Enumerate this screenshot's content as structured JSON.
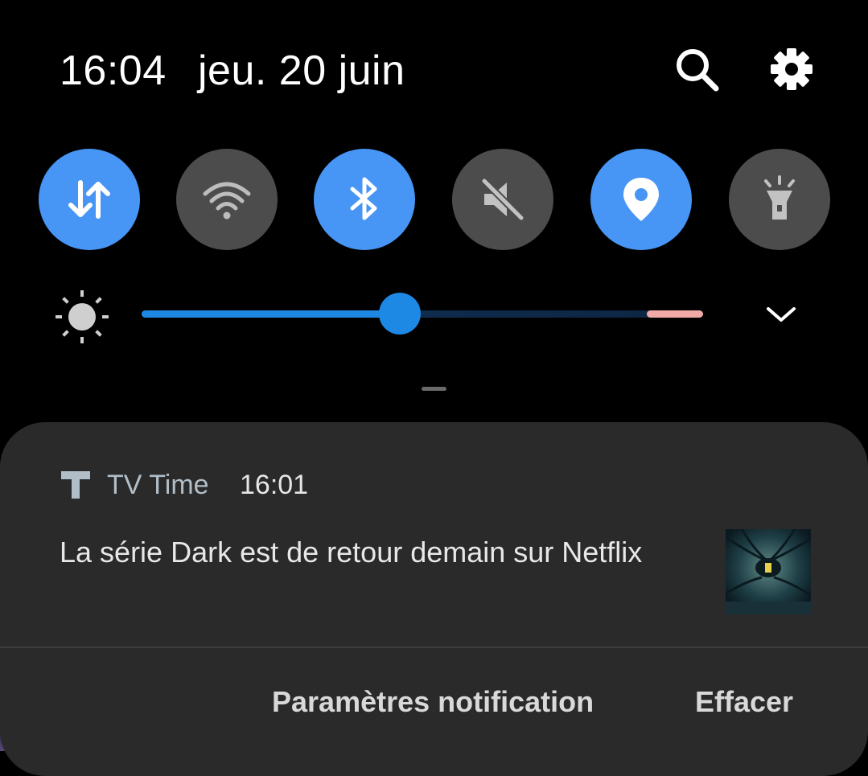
{
  "status": {
    "time": "16:04",
    "date": "jeu. 20 juin"
  },
  "header_icons": [
    {
      "name": "search-icon"
    },
    {
      "name": "gear-icon"
    }
  ],
  "quick_settings": [
    {
      "name": "mobile-data",
      "icon": "arrows-up-down-icon",
      "state": "on"
    },
    {
      "name": "wifi",
      "icon": "wifi-icon",
      "state": "off"
    },
    {
      "name": "bluetooth",
      "icon": "bluetooth-icon",
      "state": "on"
    },
    {
      "name": "sound",
      "icon": "volume-muted-icon",
      "state": "off"
    },
    {
      "name": "location",
      "icon": "location-pin-icon",
      "state": "on"
    },
    {
      "name": "flashlight",
      "icon": "flashlight-icon",
      "state": "off"
    }
  ],
  "brightness": {
    "level_percent": 46,
    "icon": "sun-icon"
  },
  "colors": {
    "tile_on": "#4795f4",
    "tile_off": "#4c4c4c",
    "slider_active": "#1e88e5",
    "card_background": "#2a2a2a"
  },
  "notification": {
    "app_name": "TV Time",
    "time": "16:01",
    "body": "La série Dark est de retour demain sur Netflix",
    "actions": {
      "settings": "Paramètres notification",
      "clear": "Effacer"
    }
  }
}
